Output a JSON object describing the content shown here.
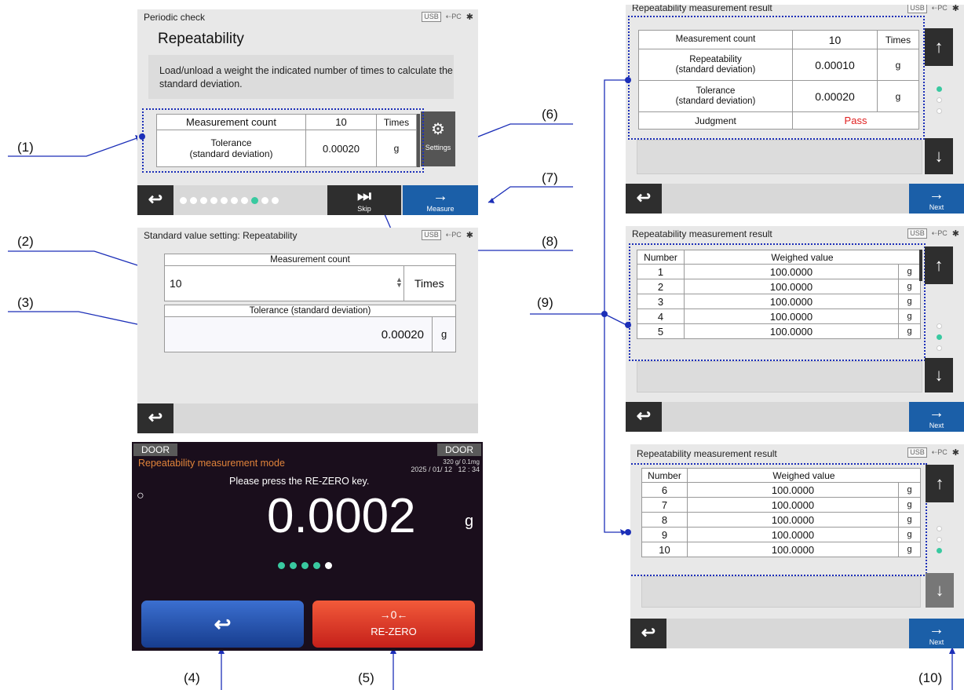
{
  "callouts": {
    "c1": "(1)",
    "c2": "(2)",
    "c3": "(3)",
    "c4": "(4)",
    "c5": "(5)",
    "c6": "(6)",
    "c7": "(7)",
    "c8": "(8)",
    "c9": "(9)",
    "c10": "(10)"
  },
  "status": {
    "usb": "USB",
    "pc": "PC",
    "bt": "✱"
  },
  "periodic": {
    "header": "Periodic check",
    "title": "Repeatability",
    "description": "Load/unload a weight the indicated number of times to calculate the standard deviation.",
    "count_label": "Measurement count",
    "count_value": "10",
    "count_unit": "Times",
    "tol_label": "Tolerance\n(standard deviation)",
    "tol_value": "0.00020",
    "tol_unit": "g",
    "settings_label": "Settings",
    "skip_label": "Skip",
    "measure_label": "Measure",
    "page_count": 10,
    "page_current": 8
  },
  "standard": {
    "header": "Standard value setting: Repeatability",
    "count_label": "Measurement count",
    "count_value": "10",
    "count_unit": "Times",
    "tol_label": "Tolerance (standard deviation)",
    "tol_value": "0.00020",
    "tol_unit": "g"
  },
  "mode": {
    "door_left": "DOOR",
    "door_right": "DOOR",
    "title": "Repeatability measurement mode",
    "capacity": "320 g/ 0.1mg",
    "datetime": "2025 / 01/ 12   12 : 34",
    "prompt": "Please press the RE-ZERO key.",
    "stable": "○",
    "value": "0.0002",
    "unit": "g",
    "rezero_symbol": "→0←",
    "rezero_label": "RE-ZERO",
    "progress_total": 5,
    "progress_done": 4
  },
  "result1": {
    "header": "Repeatability measurement result",
    "rows": [
      {
        "label": "Measurement count",
        "value": "10",
        "unit": "Times"
      },
      {
        "label": "Repeatability\n(standard deviation)",
        "value": "0.00010",
        "unit": "g"
      },
      {
        "label": "Tolerance\n(standard deviation)",
        "value": "0.00020",
        "unit": "g"
      }
    ],
    "judgment_label": "Judgment",
    "judgment_value": "Pass",
    "judgment_color": "#e02020",
    "next_label": "Next"
  },
  "result2": {
    "header": "Repeatability measurement result",
    "col_number": "Number",
    "col_value": "Weighed value",
    "rows": [
      {
        "n": "1",
        "v": "100.0000",
        "u": "g"
      },
      {
        "n": "2",
        "v": "100.0000",
        "u": "g"
      },
      {
        "n": "3",
        "v": "100.0000",
        "u": "g"
      },
      {
        "n": "4",
        "v": "100.0000",
        "u": "g"
      },
      {
        "n": "5",
        "v": "100.0000",
        "u": "g"
      }
    ],
    "next_label": "Next"
  },
  "result3": {
    "header": "Repeatability measurement result",
    "col_number": "Number",
    "col_value": "Weighed value",
    "rows": [
      {
        "n": "6",
        "v": "100.0000",
        "u": "g"
      },
      {
        "n": "7",
        "v": "100.0000",
        "u": "g"
      },
      {
        "n": "8",
        "v": "100.0000",
        "u": "g"
      },
      {
        "n": "9",
        "v": "100.0000",
        "u": "g"
      },
      {
        "n": "10",
        "v": "100.0000",
        "u": "g"
      }
    ],
    "next_label": "Next"
  },
  "colors": {
    "accent": "#1c2fb8",
    "blue_button": "#1b5fa8",
    "teal": "#39c9a0",
    "orange": "#e0833a",
    "red": "#e03a2a"
  }
}
